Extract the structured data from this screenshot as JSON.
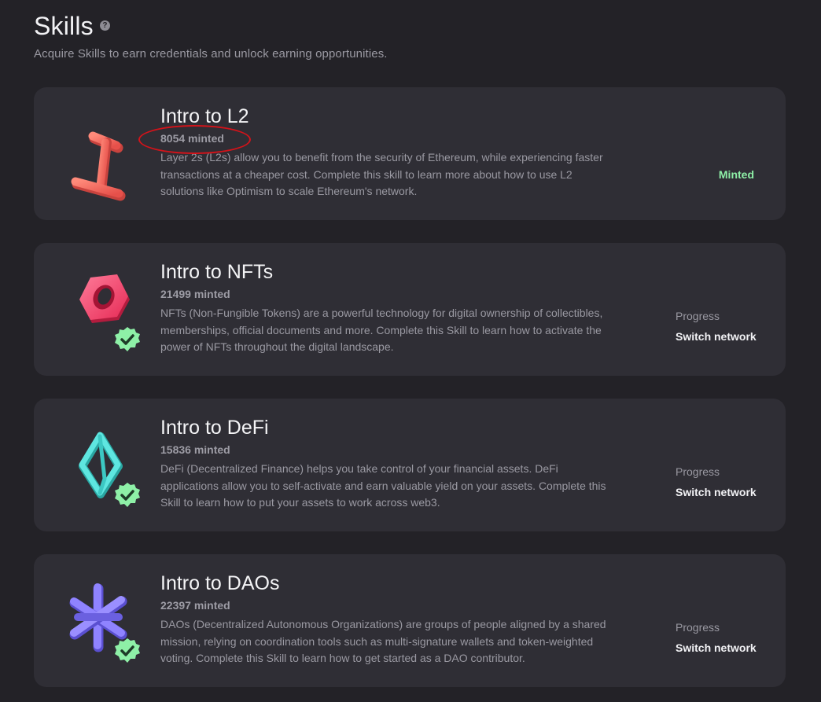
{
  "header": {
    "title": "Skills",
    "help_icon": "?",
    "subtitle": "Acquire Skills to earn credentials and unlock earning opportunities."
  },
  "skills": [
    {
      "name": "Intro to L2",
      "minted": "8054 minted",
      "description": "Layer 2s (L2s) allow you to benefit from the security of Ethereum, while experiencing faster transactions at a cheaper cost. Complete this skill to learn more about how to use L2 solutions like Optimism to scale Ethereum's network.",
      "status": "Minted",
      "icon": "l2-beam-icon",
      "color": "#f2675e"
    },
    {
      "name": "Intro to NFTs",
      "minted": "21499 minted",
      "description": "NFTs (Non-Fungible Tokens) are a powerful technology for digital ownership of collectibles, memberships, official documents and more. Complete this Skill to learn how to activate the power of NFTs throughout the digital landscape.",
      "progress_label": "Progress",
      "action_label": "Switch network",
      "icon": "nft-hex-nut-icon",
      "color": "#f0476e"
    },
    {
      "name": "Intro to DeFi",
      "minted": "15836 minted",
      "description": "DeFi (Decentralized Finance) helps you take control of your financial assets. DeFi applications allow you to self-activate and earn valuable yield on your assets. Complete this Skill to learn how to put your assets to work across web3.",
      "progress_label": "Progress",
      "action_label": "Switch network",
      "icon": "defi-octahedron-icon",
      "color": "#4fd6d2"
    },
    {
      "name": "Intro to DAOs",
      "minted": "22397 minted",
      "description": "DAOs (Decentralized Autonomous Organizations) are groups of people aligned by a shared mission, relying on coordination tools such as multi-signature wallets and token-weighted voting. Complete this Skill to learn how to get started as a DAO contributor.",
      "progress_label": "Progress",
      "action_label": "Switch network",
      "icon": "dao-asterisk-icon",
      "color": "#7a6cf2"
    }
  ],
  "colors": {
    "background": "#232227",
    "card": "#2f2e35",
    "minted_status": "#8ef0a7",
    "check_badge": "#8ef0a7",
    "annotation": "#d2131a"
  }
}
